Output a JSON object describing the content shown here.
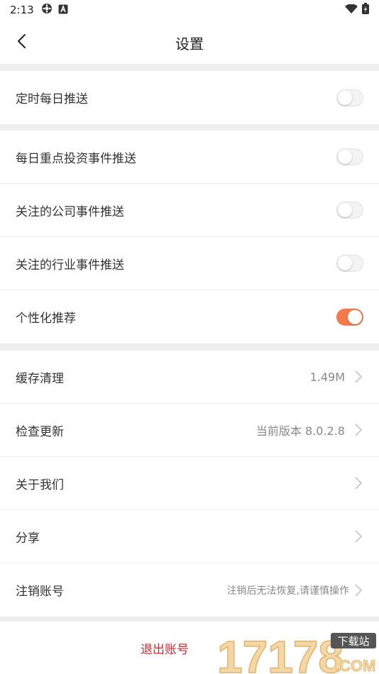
{
  "status_bar": {
    "time": "2:13"
  },
  "header": {
    "title": "设置"
  },
  "group1": {
    "items": [
      {
        "label": "定时每日推送",
        "toggle_on": false
      }
    ]
  },
  "group2": {
    "items": [
      {
        "label": "每日重点投资事件推送",
        "toggle_on": false
      },
      {
        "label": "关注的公司事件推送",
        "toggle_on": false
      },
      {
        "label": "关注的行业事件推送",
        "toggle_on": false
      },
      {
        "label": "个性化推荐",
        "toggle_on": true
      }
    ]
  },
  "group3": {
    "items": [
      {
        "label": "缓存清理",
        "value": "1.49M"
      },
      {
        "label": "检查更新",
        "value": "当前版本 8.0.2.8"
      },
      {
        "label": "关于我们",
        "value": ""
      },
      {
        "label": "分享",
        "value": ""
      },
      {
        "label": "注销账号",
        "value": "注销后无法恢复,请谨慎操作"
      }
    ]
  },
  "logout": {
    "label": "退出账号"
  },
  "watermark": {
    "number": "17178",
    "tag": "下载站",
    "domain": ".COM"
  },
  "colors": {
    "accent": "#f47a4c",
    "logout_text": "#d6262a",
    "background": "#efefef"
  }
}
